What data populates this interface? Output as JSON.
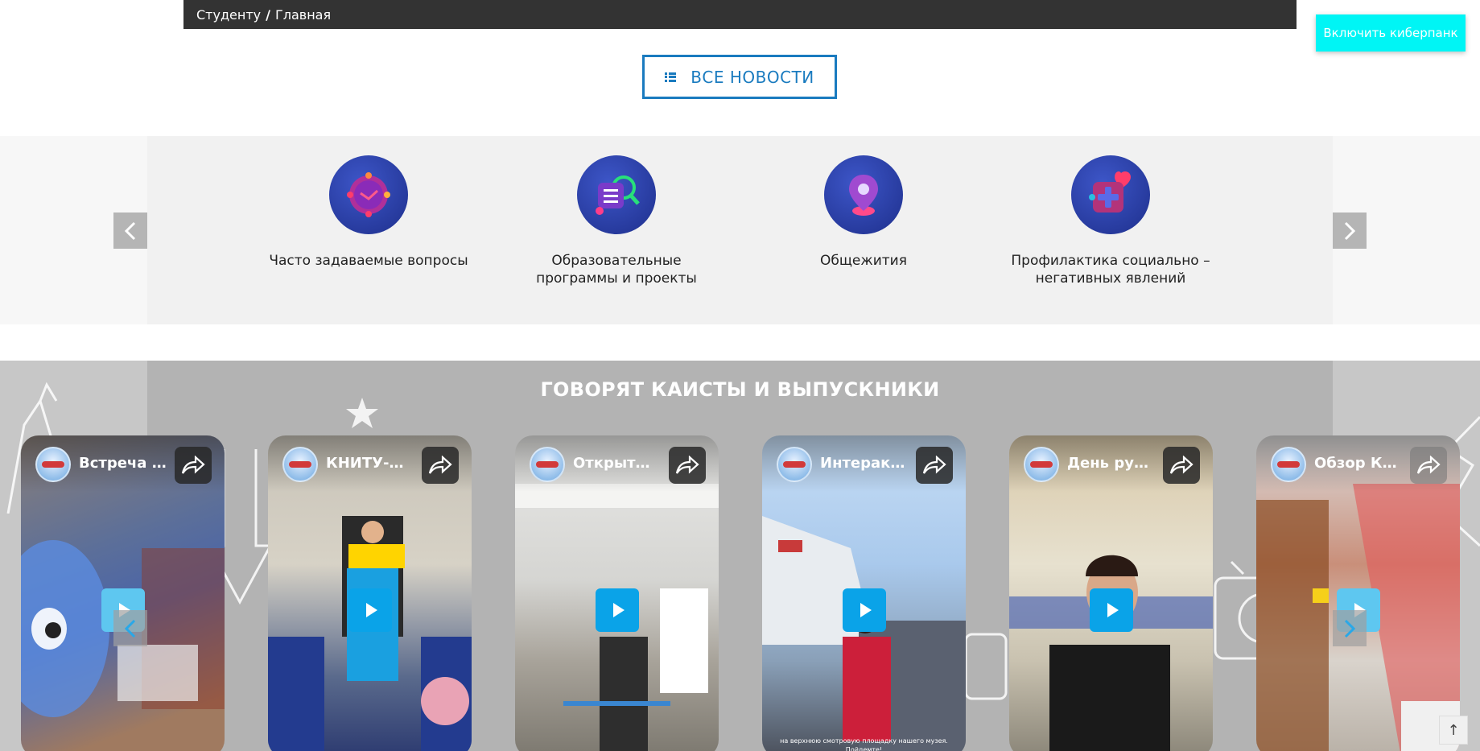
{
  "breadcrumb": {
    "items": [
      "Студенту",
      "Главная"
    ],
    "separator": "/"
  },
  "cyberpunk_button": "Включить киберпанк",
  "all_news_button": "ВСЕ НОВОСТИ",
  "services": {
    "prev_icon": "chevron-left-icon",
    "next_icon": "chevron-right-icon",
    "items": [
      {
        "label": "Часто задаваемые вопросы",
        "icon": "clock-icon"
      },
      {
        "label": "Образовательные программы и проекты",
        "icon": "search-list-icon"
      },
      {
        "label": "Общежития",
        "icon": "location-pin-icon"
      },
      {
        "label": "Профилактика социально – негативных явлений",
        "icon": "medical-plus-heart-icon"
      }
    ]
  },
  "testimonials": {
    "title": "ГОВОРЯТ КАИСТЫ И ВЫПУСКНИКИ",
    "videos": [
      {
        "title": "Встреча и.о. ректора"
      },
      {
        "title": "КНИТУ-КАИ"
      },
      {
        "title": "Открытый урок"
      },
      {
        "title": "Интерактивный музей"
      },
      {
        "title": "День русского языка"
      },
      {
        "title": "Обзор КАИ"
      }
    ],
    "video4_caption": "на верхнюю смотровую площадку нашего музея. Пойдемте!"
  },
  "scroll_top_label": "↑",
  "colors": {
    "accent": "#1a7bbf",
    "cyan": "#00f5f5",
    "play": "#0aa3e8",
    "breadcrumb_bg": "#333333"
  }
}
